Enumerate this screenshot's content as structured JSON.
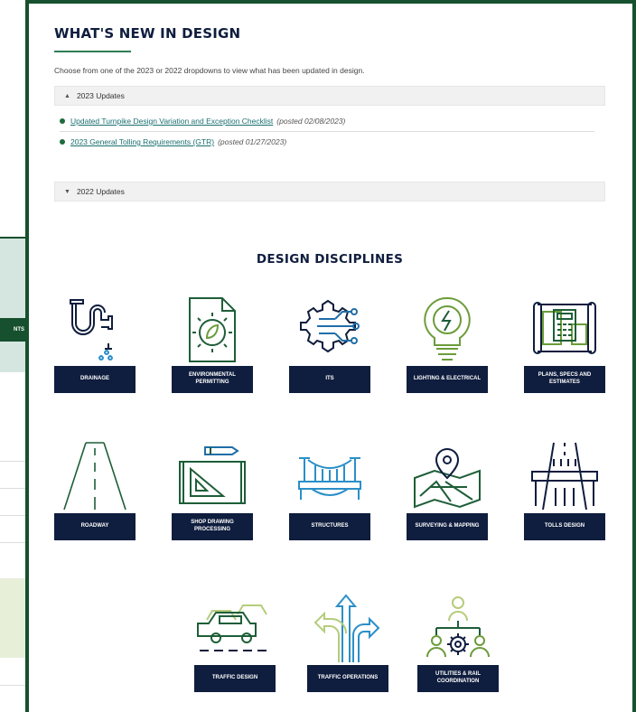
{
  "background": {
    "tab_fragment": "NTS"
  },
  "whats_new": {
    "title": "WHAT'S NEW IN DESIGN",
    "intro": "Choose from one of the 2023 or 2022 dropdowns to view what has been updated in design."
  },
  "updates_2023": {
    "label": "2023 Updates",
    "chevron": "chevron-up-icon",
    "items": [
      {
        "link": "Updated Turnpike Design Variation and Exception Checklist",
        "posted": "(posted 02/08/2023)"
      },
      {
        "link": "2023 General Tolling Requirements (GTR)",
        "posted": "(posted 01/27/2023)"
      }
    ]
  },
  "updates_2022": {
    "label": "2022 Updates",
    "chevron": "chevron-down-icon"
  },
  "disciplines": {
    "title": "DESIGN DISCIPLINES",
    "items": [
      {
        "label": "DRAINAGE",
        "icon": "drainage-pipe-icon"
      },
      {
        "label": "ENVIRONMENTAL PERMITTING",
        "icon": "environmental-gear-document-icon"
      },
      {
        "label": "ITS",
        "icon": "its-circuit-icon"
      },
      {
        "label": "LIGHTING & ELECTRICAL",
        "icon": "lightbulb-icon"
      },
      {
        "label": "PLANS, SPECS AND ESTIMATES",
        "icon": "plans-calculator-icon"
      },
      {
        "label": "ROADWAY",
        "icon": "roadway-icon"
      },
      {
        "label": "SHOP DRAWING PROCESSING",
        "icon": "drawing-board-icon"
      },
      {
        "label": "STRUCTURES",
        "icon": "bridge-icon"
      },
      {
        "label": "SURVEYING & MAPPING",
        "icon": "map-pin-icon"
      },
      {
        "label": "TOLLS DESIGN",
        "icon": "toll-gantry-icon"
      },
      {
        "label": "TRAFFIC DESIGN",
        "icon": "traffic-cars-icon"
      },
      {
        "label": "TRAFFIC OPERATIONS",
        "icon": "traffic-arrows-icon"
      },
      {
        "label": "UTILITIES & RAIL COORDINATION",
        "icon": "people-gear-icon"
      }
    ]
  },
  "colors": {
    "navy": "#0f1d3e",
    "green": "#16502e",
    "link": "#1a6f70"
  }
}
